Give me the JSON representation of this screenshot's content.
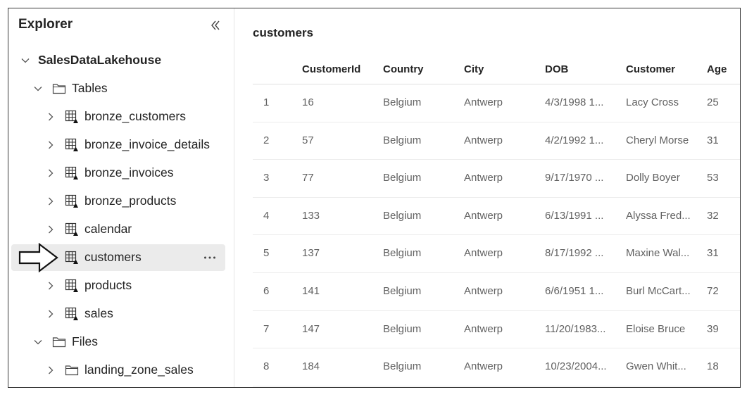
{
  "explorer": {
    "title": "Explorer",
    "collapse_icon": "double-chevron-left-icon",
    "lakehouse": {
      "label": "SalesDataLakehouse",
      "expanded": true
    },
    "tables_folder": {
      "label": "Tables",
      "expanded": true
    },
    "tables": [
      {
        "label": "bronze_customers",
        "selected": false
      },
      {
        "label": "bronze_invoice_details",
        "selected": false
      },
      {
        "label": "bronze_invoices",
        "selected": false
      },
      {
        "label": "bronze_products",
        "selected": false
      },
      {
        "label": "calendar",
        "selected": false
      },
      {
        "label": "customers",
        "selected": true
      },
      {
        "label": "products",
        "selected": false
      },
      {
        "label": "sales",
        "selected": false
      }
    ],
    "files_folder": {
      "label": "Files",
      "expanded": true
    },
    "files": [
      {
        "label": "landing_zone_sales"
      }
    ],
    "more_actions": "..."
  },
  "table": {
    "title": "customers",
    "columns": [
      "",
      "CustomerId",
      "Country",
      "City",
      "DOB",
      "Customer",
      "Age"
    ],
    "rows": [
      [
        "1",
        "16",
        "Belgium",
        "Antwerp",
        "4/3/1998 1...",
        "Lacy Cross",
        "25"
      ],
      [
        "2",
        "57",
        "Belgium",
        "Antwerp",
        "4/2/1992 1...",
        "Cheryl Morse",
        "31"
      ],
      [
        "3",
        "77",
        "Belgium",
        "Antwerp",
        "9/17/1970 ...",
        "Dolly Boyer",
        "53"
      ],
      [
        "4",
        "133",
        "Belgium",
        "Antwerp",
        "6/13/1991 ...",
        "Alyssa Fred...",
        "32"
      ],
      [
        "5",
        "137",
        "Belgium",
        "Antwerp",
        "8/17/1992 ...",
        "Maxine Wal...",
        "31"
      ],
      [
        "6",
        "141",
        "Belgium",
        "Antwerp",
        "6/6/1951 1...",
        "Burl McCart...",
        "72"
      ],
      [
        "7",
        "147",
        "Belgium",
        "Antwerp",
        "11/20/1983...",
        "Eloise Bruce",
        "39"
      ],
      [
        "8",
        "184",
        "Belgium",
        "Antwerp",
        "10/23/2004...",
        "Gwen Whit...",
        "18"
      ]
    ]
  },
  "colors": {
    "selected_bg": "#ebebeb",
    "text": "#242424",
    "muted_text": "#616161",
    "border": "#3a3a3a"
  }
}
